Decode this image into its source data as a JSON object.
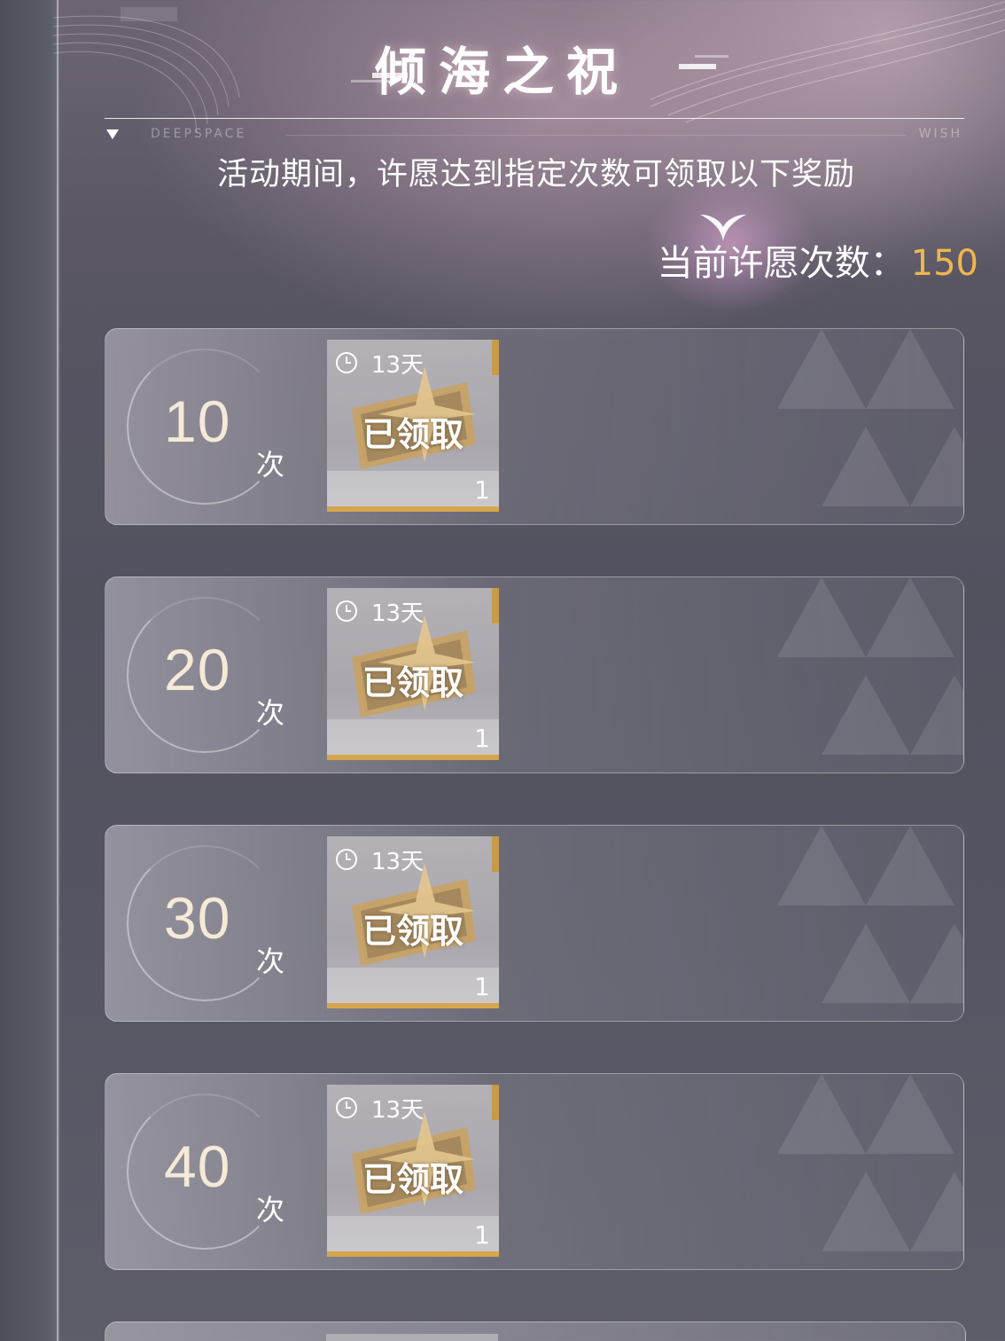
{
  "header": {
    "title": "倾海之祝",
    "divider_left_label": "DEEPSPACE",
    "divider_right_label": "WISH",
    "subtitle": "活动期间，许愿达到指定次数可领取以下奖励"
  },
  "wish_count": {
    "label": "当前许愿次数：",
    "value": "150"
  },
  "rewards": [
    {
      "count": "10",
      "unit": "次",
      "duration": "13天",
      "status": "已领取",
      "quantity": "1"
    },
    {
      "count": "20",
      "unit": "次",
      "duration": "13天",
      "status": "已领取",
      "quantity": "1"
    },
    {
      "count": "30",
      "unit": "次",
      "duration": "13天",
      "status": "已领取",
      "quantity": "1"
    },
    {
      "count": "40",
      "unit": "次",
      "duration": "13天",
      "status": "已领取",
      "quantity": "1"
    }
  ],
  "colors": {
    "accent_gold": "#f0b64e",
    "count_text": "#f5e9d7",
    "item_gold_bar": "#d5a64c"
  }
}
